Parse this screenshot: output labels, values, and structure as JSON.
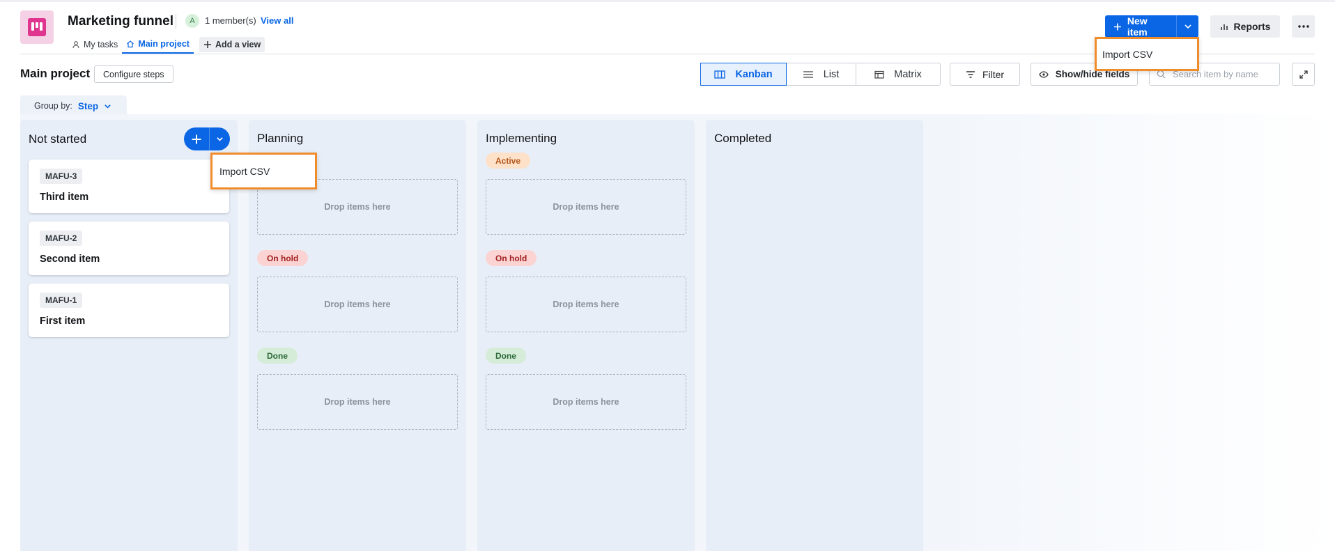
{
  "header": {
    "title": "Marketing funnel",
    "member_avatar": "A",
    "members": "1 member(s)",
    "view_all": "View all",
    "tabs": [
      {
        "label": "My tasks",
        "icon": "person-icon"
      },
      {
        "label": "Main project",
        "icon": "home-icon",
        "active": true
      },
      {
        "label": "Add a view",
        "icon": "plus-icon"
      }
    ],
    "new_item_label": "New item",
    "reports_label": "Reports",
    "new_item_menu": [
      "Import CSV"
    ]
  },
  "toolbar": {
    "section_title": "Main project",
    "configure_label": "Configure steps",
    "views": [
      {
        "label": "Kanban",
        "icon": "kanban-icon",
        "active": true
      },
      {
        "label": "List",
        "icon": "list-icon"
      },
      {
        "label": "Matrix",
        "icon": "matrix-icon"
      }
    ],
    "filter_label": "Filter",
    "show_hide_label": "Show/hide fields",
    "search_placeholder": "Search item by name",
    "group_by_label": "Group by:",
    "group_by_value": "Step"
  },
  "columns": [
    {
      "title": "Not started",
      "cards": [
        {
          "key": "MAFU-3",
          "name": "Third item"
        },
        {
          "key": "MAFU-2",
          "name": "Second item"
        },
        {
          "key": "MAFU-1",
          "name": "First item"
        }
      ],
      "add_menu": [
        "Import CSV"
      ]
    },
    {
      "title": "Planning",
      "statuses": [
        {
          "label": "",
          "drop_text": "Drop items here"
        },
        {
          "label": "On hold",
          "drop_text": "Drop items here"
        },
        {
          "label": "Done",
          "drop_text": "Drop items here"
        }
      ]
    },
    {
      "title": "Implementing",
      "statuses": [
        {
          "label": "Active",
          "drop_text": "Drop items here"
        },
        {
          "label": "On hold",
          "drop_text": "Drop items here"
        },
        {
          "label": "Done",
          "drop_text": "Drop items here"
        }
      ]
    },
    {
      "title": "Completed"
    }
  ],
  "colors": {
    "accent": "#0a66e4",
    "highlight": "#f18c2b",
    "app_brand": "#e0358f"
  }
}
